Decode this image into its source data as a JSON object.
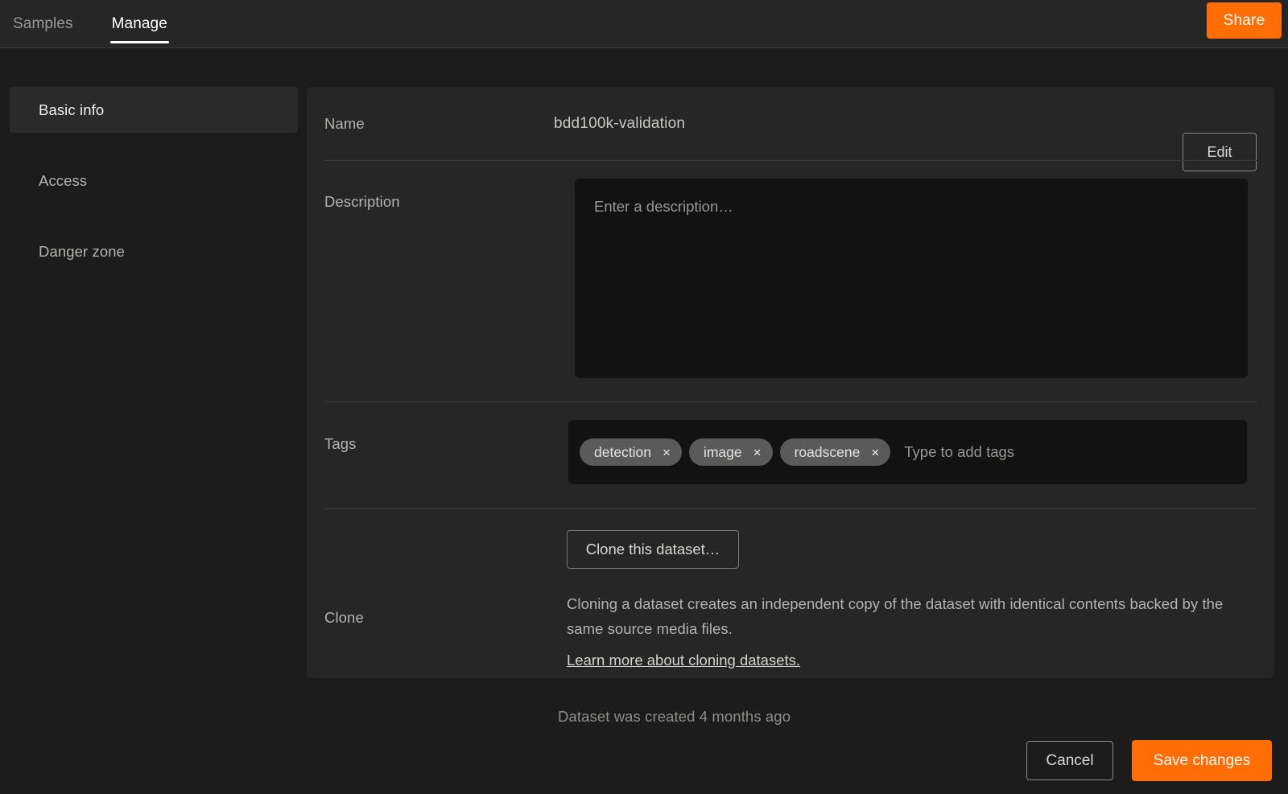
{
  "header": {
    "tabs": [
      {
        "label": "Samples",
        "active": false
      },
      {
        "label": "Manage",
        "active": true
      }
    ],
    "share_label": "Share"
  },
  "sidebar": {
    "items": [
      {
        "label": "Basic info",
        "active": true
      },
      {
        "label": "Access",
        "active": false
      },
      {
        "label": "Danger zone",
        "active": false
      }
    ]
  },
  "form": {
    "name": {
      "label": "Name",
      "value": "bdd100k-validation",
      "edit_label": "Edit"
    },
    "description": {
      "label": "Description",
      "value": "",
      "placeholder": "Enter a description…"
    },
    "tags": {
      "label": "Tags",
      "items": [
        "detection",
        "image",
        "roadscene"
      ],
      "remove_icon": "×",
      "placeholder": "Type to add tags"
    },
    "clone": {
      "label": "Clone",
      "button_label": "Clone this dataset…",
      "description": "Cloning a dataset creates an independent copy of the dataset with identical contents backed by the same source media files.",
      "link_label": "Learn more about cloning datasets."
    }
  },
  "footer": {
    "created_note": "Dataset was created 4 months ago",
    "cancel_label": "Cancel",
    "save_label": "Save changes"
  },
  "colors": {
    "accent": "#ff6d04",
    "background": "#1c1c1c",
    "panel": "#262626",
    "field": "#121212",
    "tag_pill": "#5a5a5a"
  }
}
